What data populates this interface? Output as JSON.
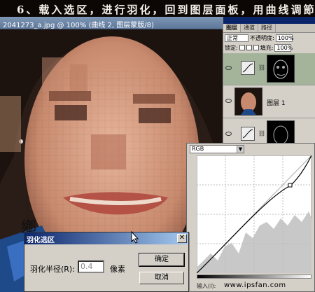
{
  "banner": {
    "text": "6、载入选区，进行羽化，回到图层面板，用曲线调節"
  },
  "document": {
    "title": "2041273_a.jpg @ 100% (曲线 2, 图层蒙版/8)"
  },
  "layers_panel": {
    "tabs": [
      "图层",
      "通道",
      "路径"
    ],
    "blend_mode": "正常",
    "opacity_label": "不透明度:",
    "opacity_value": "100%",
    "lock_label": "锁定:",
    "fill_label": "填充:",
    "fill_value": "100%",
    "layers": [
      {
        "name": "",
        "type": "adjustment-curves",
        "selected": true
      },
      {
        "name": "图层 1",
        "type": "photo"
      },
      {
        "name": "",
        "type": "adjustment-curves"
      }
    ]
  },
  "curves": {
    "channel": "RGB",
    "input_label": "输入(I):"
  },
  "feather_dialog": {
    "title": "羽化选区",
    "radius_label": "羽化半径(R):",
    "radius_value": "0.4",
    "unit": "像素",
    "ok_label": "确定",
    "cancel_label": "取消"
  },
  "watermark": "www.ipsfan.com",
  "colors": {
    "banner_bg": "#0c0604",
    "dialog_bg": "#d4d0c8",
    "title_gradient_start": "#0a246a",
    "selected_layer": "#a4b49a"
  }
}
